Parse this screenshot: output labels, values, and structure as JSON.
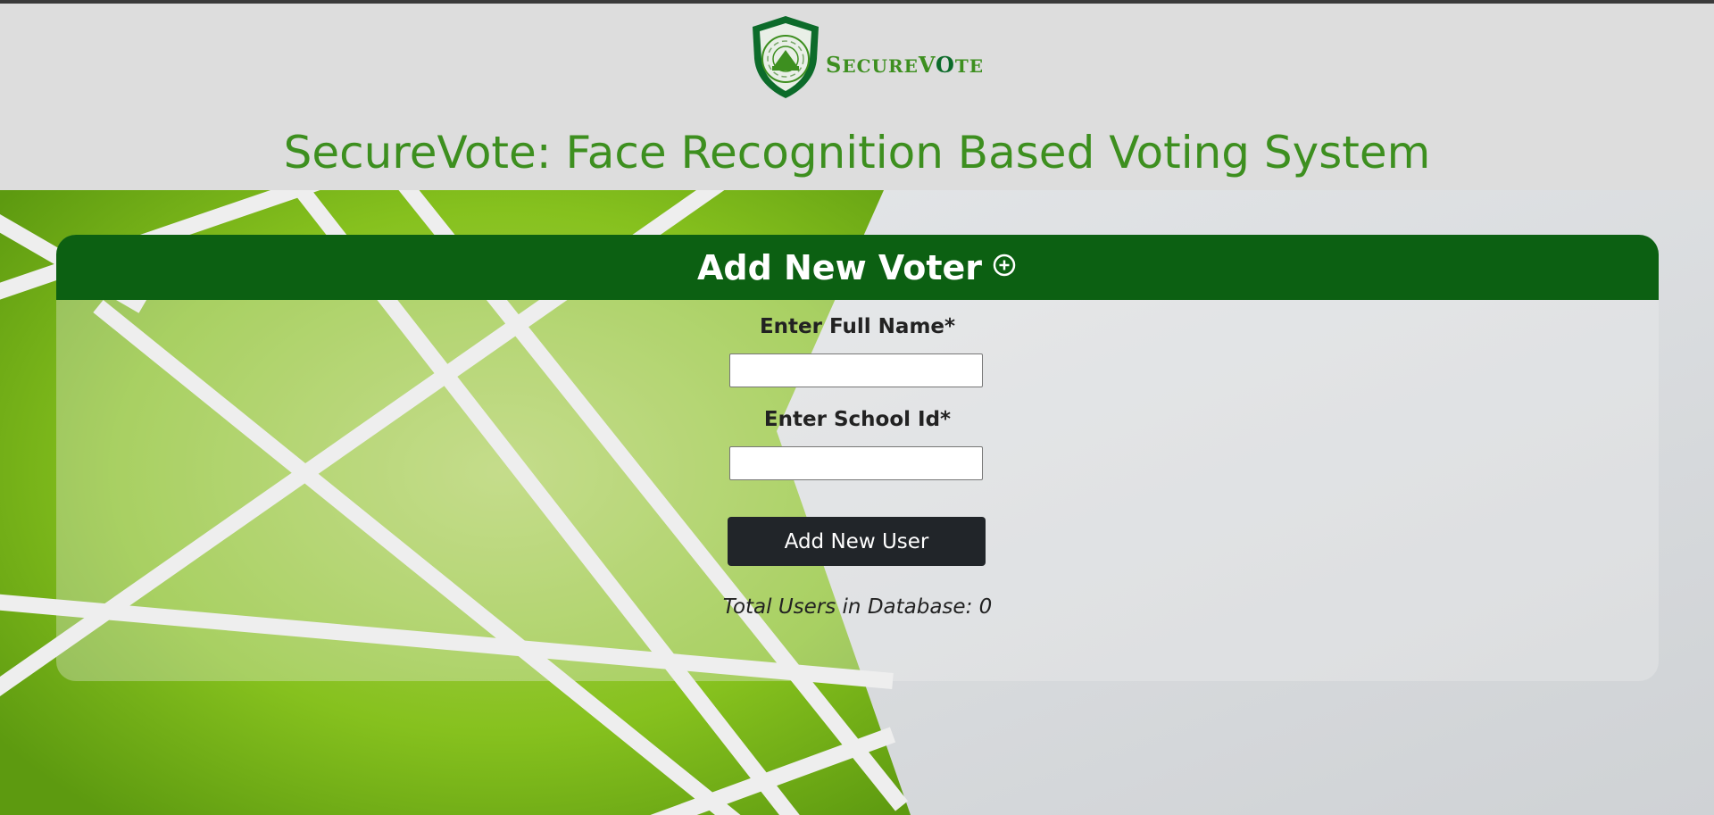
{
  "logo": {
    "name": "SecureVote",
    "word_parts": [
      "S",
      "ECURE",
      "V",
      "O",
      "TE"
    ],
    "colors": {
      "shield": "#0c6b2a",
      "text": "#3d8f1f"
    }
  },
  "header": {
    "title": "SecureVote: Face Recognition Based Voting System",
    "title_color": "#3d8f1f"
  },
  "card": {
    "title": "Add New Voter",
    "title_icon": "plus-circle-icon",
    "header_color": "#0c6012",
    "fields": [
      {
        "label": "Enter Full Name*",
        "value": "",
        "placeholder": ""
      },
      {
        "label": "Enter School Id*",
        "value": "",
        "placeholder": ""
      }
    ],
    "submit_label": "Add New User",
    "total_users": "Total Users in Database: 0"
  },
  "colors": {
    "background_green": "#7cbf1a",
    "button_dark": "#212529"
  }
}
